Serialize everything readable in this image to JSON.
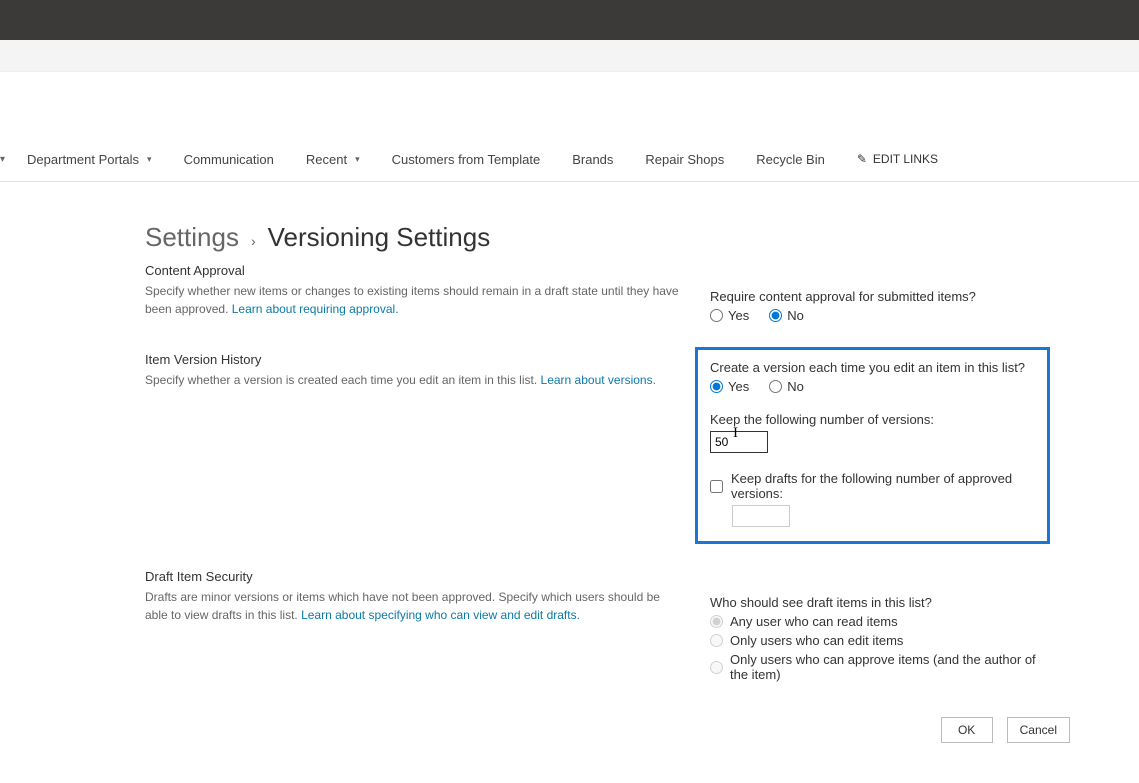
{
  "nav": {
    "items": [
      {
        "label": "Department Portals",
        "dropdown": true
      },
      {
        "label": "Communication",
        "dropdown": false
      },
      {
        "label": "Recent",
        "dropdown": true
      },
      {
        "label": "Customers from Template",
        "dropdown": false
      },
      {
        "label": "Brands",
        "dropdown": false
      },
      {
        "label": "Repair Shops",
        "dropdown": false
      },
      {
        "label": "Recycle Bin",
        "dropdown": false
      }
    ],
    "edit_links": "EDIT LINKS"
  },
  "breadcrumb": {
    "parent": "Settings",
    "sep": "›",
    "title": "Versioning Settings"
  },
  "content_approval": {
    "heading": "Content Approval",
    "desc": "Specify whether new items or changes to existing items should remain in a draft state until they have been approved.  ",
    "link": "Learn about requiring approval.",
    "question": "Require content approval for submitted items?",
    "yes": "Yes",
    "no": "No",
    "selected": "no"
  },
  "version_history": {
    "heading": "Item Version History",
    "desc": "Specify whether a version is created each time you edit an item in this list.  ",
    "link": "Learn about versions.",
    "question": "Create a version each time you edit an item in this list?",
    "yes": "Yes",
    "no": "No",
    "selected": "yes",
    "keep_label": "Keep the following number of versions:",
    "keep_value": "50",
    "drafts_check_label": "Keep drafts for the following number of approved versions:",
    "drafts_value": ""
  },
  "draft_security": {
    "heading": "Draft Item Security",
    "desc": "Drafts are minor versions or items which have not been approved. Specify which users should be able to view drafts in this list.  ",
    "link": "Learn about specifying who can view and edit drafts.",
    "question": "Who should see draft items in this list?",
    "opts": [
      "Any user who can read items",
      "Only users who can edit items",
      "Only users who can approve items (and the author of the item)"
    ],
    "selected": 0
  },
  "buttons": {
    "ok": "OK",
    "cancel": "Cancel"
  }
}
